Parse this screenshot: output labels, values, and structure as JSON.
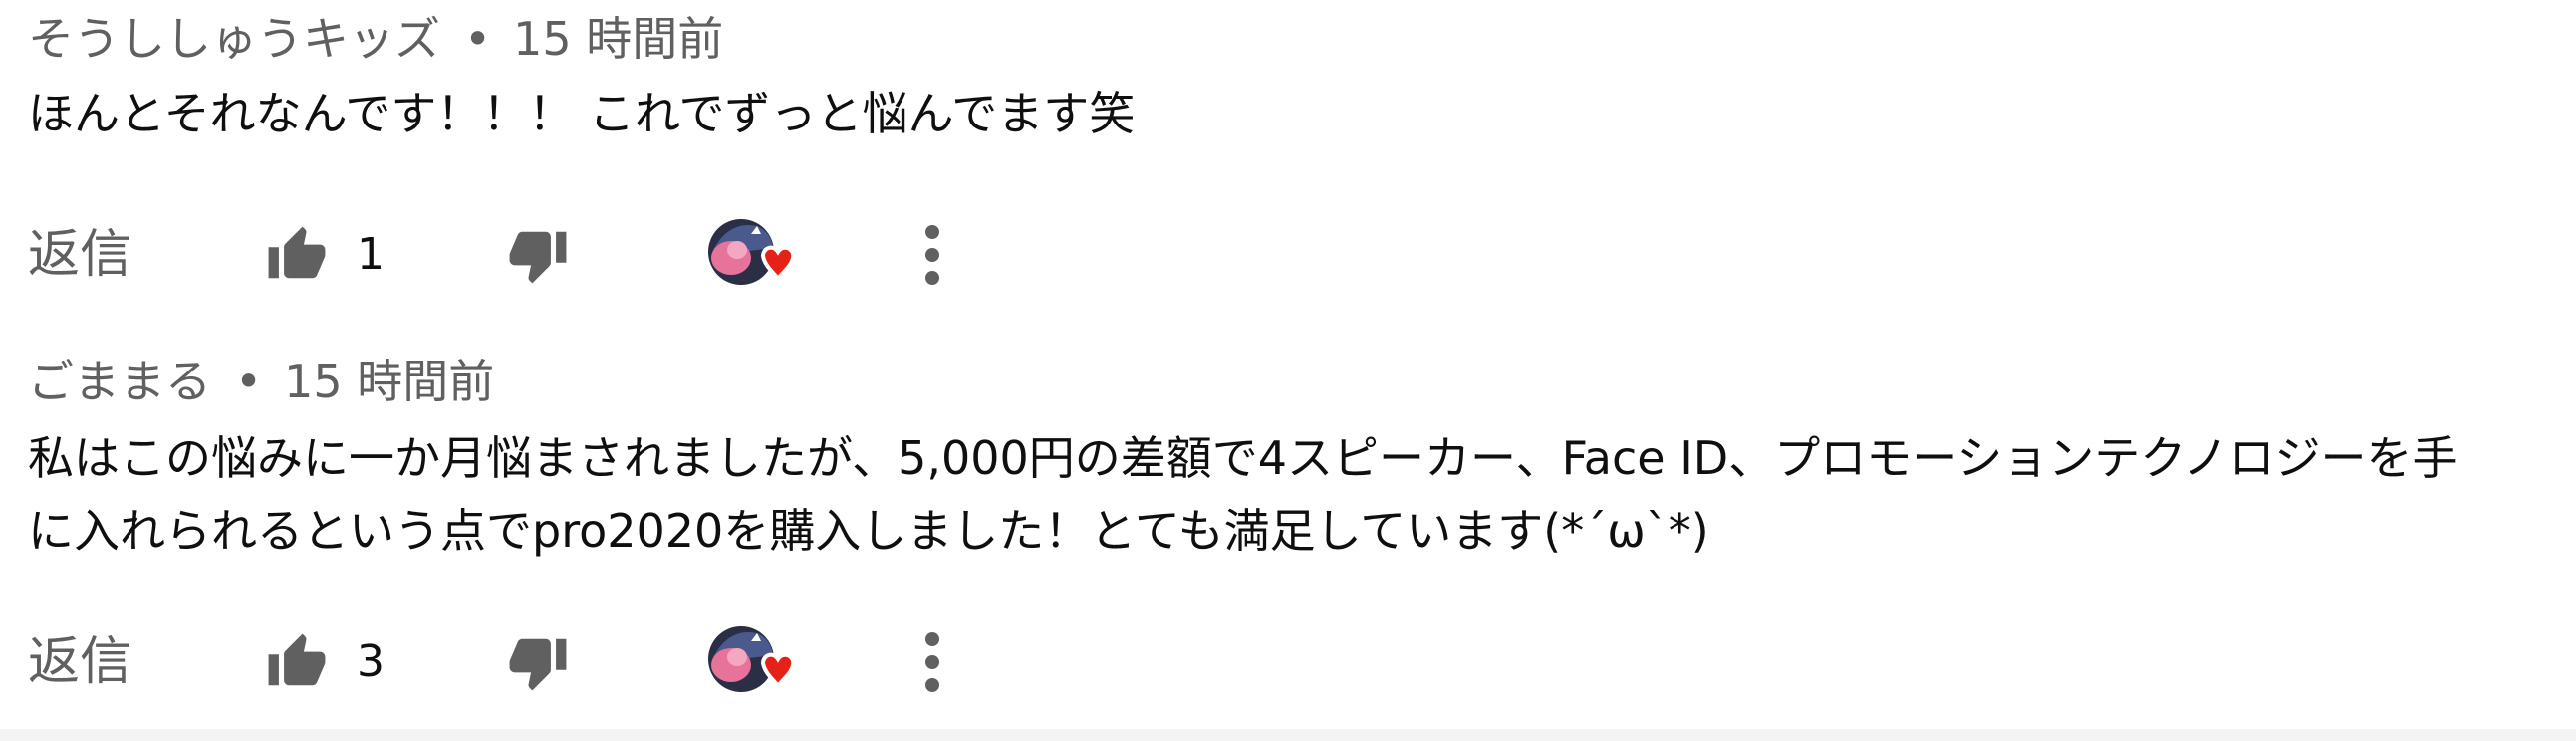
{
  "comments": [
    {
      "author": "そうししゅうキッズ",
      "separator": "•",
      "time": "15 時間前",
      "lines": [
        "ほんとそれなんです！！！ これでずっと悩んでます笑"
      ],
      "reply_label": "返信",
      "like_count": "1",
      "hearted": true
    },
    {
      "author": "ごままる",
      "separator": "•",
      "time": "15 時間前",
      "lines": [
        "私はこの悩みに一か月悩まされましたが、5,000円の差額で4スピーカー、Face ID、プロモーションテクノロジーを手",
        "に入れられるという点でpro2020を購入しました！とても満足しています(*´ω`*)"
      ],
      "reply_label": "返信",
      "like_count": "3",
      "hearted": true
    }
  ],
  "icons": {
    "like": "thumbs-up-icon",
    "dislike": "thumbs-down-icon",
    "creator_heart": "creator-heart-icon",
    "more": "more-vert-icon"
  },
  "colors": {
    "secondary_text": "#606060",
    "primary_text": "#0f0f0f",
    "icon": "#606060",
    "heart": "#e62117"
  }
}
